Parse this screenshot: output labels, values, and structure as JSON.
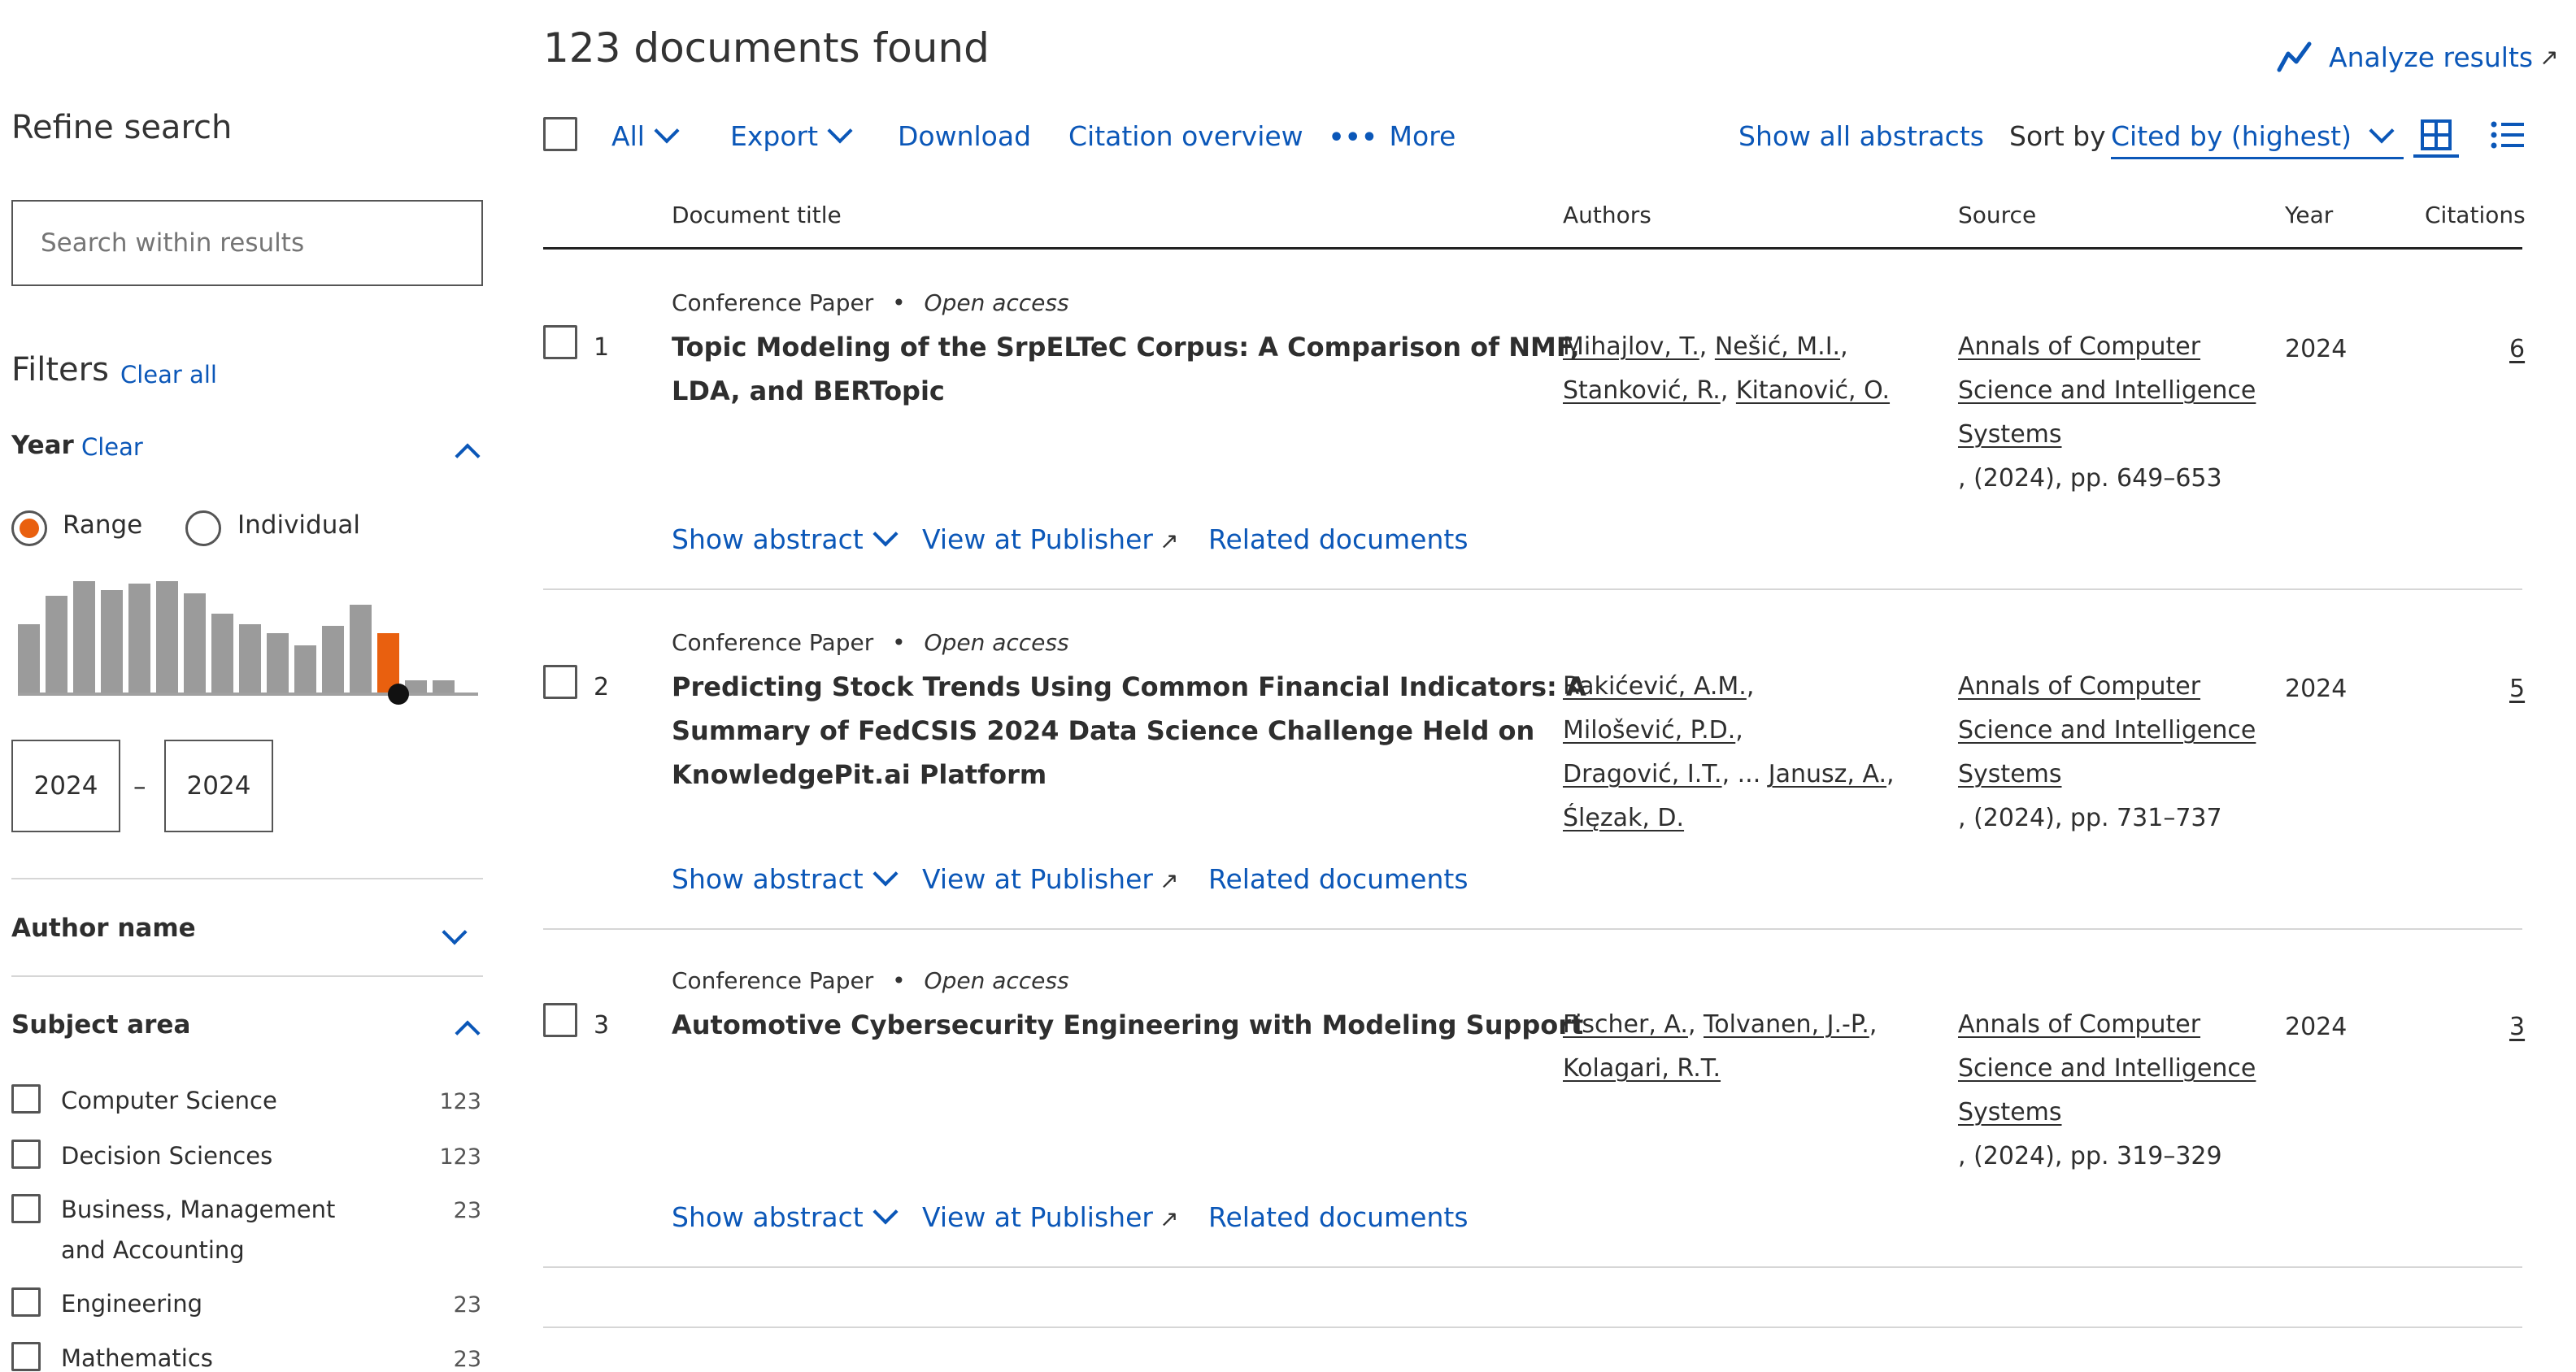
{
  "header": {
    "results_count": "123 documents found",
    "analyze": "Analyze results"
  },
  "toolbar": {
    "all": "All",
    "export": "Export",
    "download": "Download",
    "citation_overview": "Citation overview",
    "more": "More",
    "show_all_abstracts": "Show all abstracts",
    "sort_by": "Sort by",
    "sort_value": "Cited by (highest)"
  },
  "columns": {
    "title": "Document title",
    "authors": "Authors",
    "source": "Source",
    "year": "Year",
    "citations": "Citations"
  },
  "sidebar": {
    "refine": "Refine search",
    "search_placeholder": "Search within results",
    "filters": "Filters",
    "clear_all": "Clear all",
    "year_label": "Year",
    "year_clear": "Clear",
    "range": "Range",
    "individual": "Individual",
    "year_from": "2024",
    "year_dash": "–",
    "year_to": "2024",
    "histogram_level": [
      0.55,
      0.78,
      0.9,
      0.83,
      0.88,
      0.9,
      0.8,
      0.64,
      0.55,
      0.48,
      0.38,
      0.54,
      0.71,
      0.48,
      0.1,
      0.1
    ],
    "histogram_selected_index": 13,
    "author_name": "Author name",
    "subject_area": "Subject area",
    "subjects": [
      {
        "label": "Computer Science",
        "count": "123"
      },
      {
        "label": "Decision Sciences",
        "count": "123"
      },
      {
        "label": "Business, Management",
        "label2": "and Accounting",
        "count": "23"
      },
      {
        "label": "Engineering",
        "count": "23"
      },
      {
        "label": "Mathematics",
        "count": "23"
      }
    ]
  },
  "results": [
    {
      "num": "1",
      "type": "Conference Paper",
      "access": "Open access",
      "title_l1": "Topic Modeling of the SrpELTeC Corpus: A Comparison of NMF,",
      "title_l2": "LDA, and BERTopic",
      "authors": [
        [
          "Mihajlov, T.",
          "Nešić, M.I."
        ],
        [
          "Stanković, R.",
          "Kitanović, O."
        ]
      ],
      "source_l1": "Annals of Computer",
      "source_l2": "Science and Intelligence",
      "source_l3": "Systems",
      "source_detail": ", (2024), pp. 649–653",
      "year": "2024",
      "citations": "6"
    },
    {
      "num": "2",
      "type": "Conference Paper",
      "access": "Open access",
      "title_l1": "Predicting Stock Trends Using Common Financial Indicators: A",
      "title_l2": "Summary of FedCSIS 2024 Data Science Challenge Held on",
      "title_l3": "KnowledgePit.ai Platform",
      "authors": [
        [
          "Rakićević, A.M."
        ],
        [
          "Milošević, P.D."
        ],
        [
          "Dragović, I.T.",
          "Janusz, A."
        ],
        [
          "Ślęzak, D."
        ]
      ],
      "ellipsis": "...",
      "source_l1": "Annals of Computer",
      "source_l2": "Science and Intelligence",
      "source_l3": "Systems",
      "source_detail": ", (2024), pp. 731–737",
      "year": "2024",
      "citations": "5"
    },
    {
      "num": "3",
      "type": "Conference Paper",
      "access": "Open access",
      "title_l1": "Automotive Cybersecurity Engineering with Modeling Support",
      "authors": [
        [
          "Fischer, A.",
          "Tolvanen, J.-P."
        ],
        [
          "Kolagari, R.T."
        ]
      ],
      "source_l1": "Annals of Computer",
      "source_l2": "Science and Intelligence",
      "source_l3": "Systems",
      "source_detail": ", (2024), pp. 319–329",
      "year": "2024",
      "citations": "3"
    }
  ],
  "actions": {
    "show_abstract": "Show abstract",
    "view_publisher": "View at Publisher",
    "related": "Related documents"
  },
  "colors": {
    "link": "#0b57b8",
    "accent": "#e9600f",
    "bar": "#9b9b9b"
  }
}
